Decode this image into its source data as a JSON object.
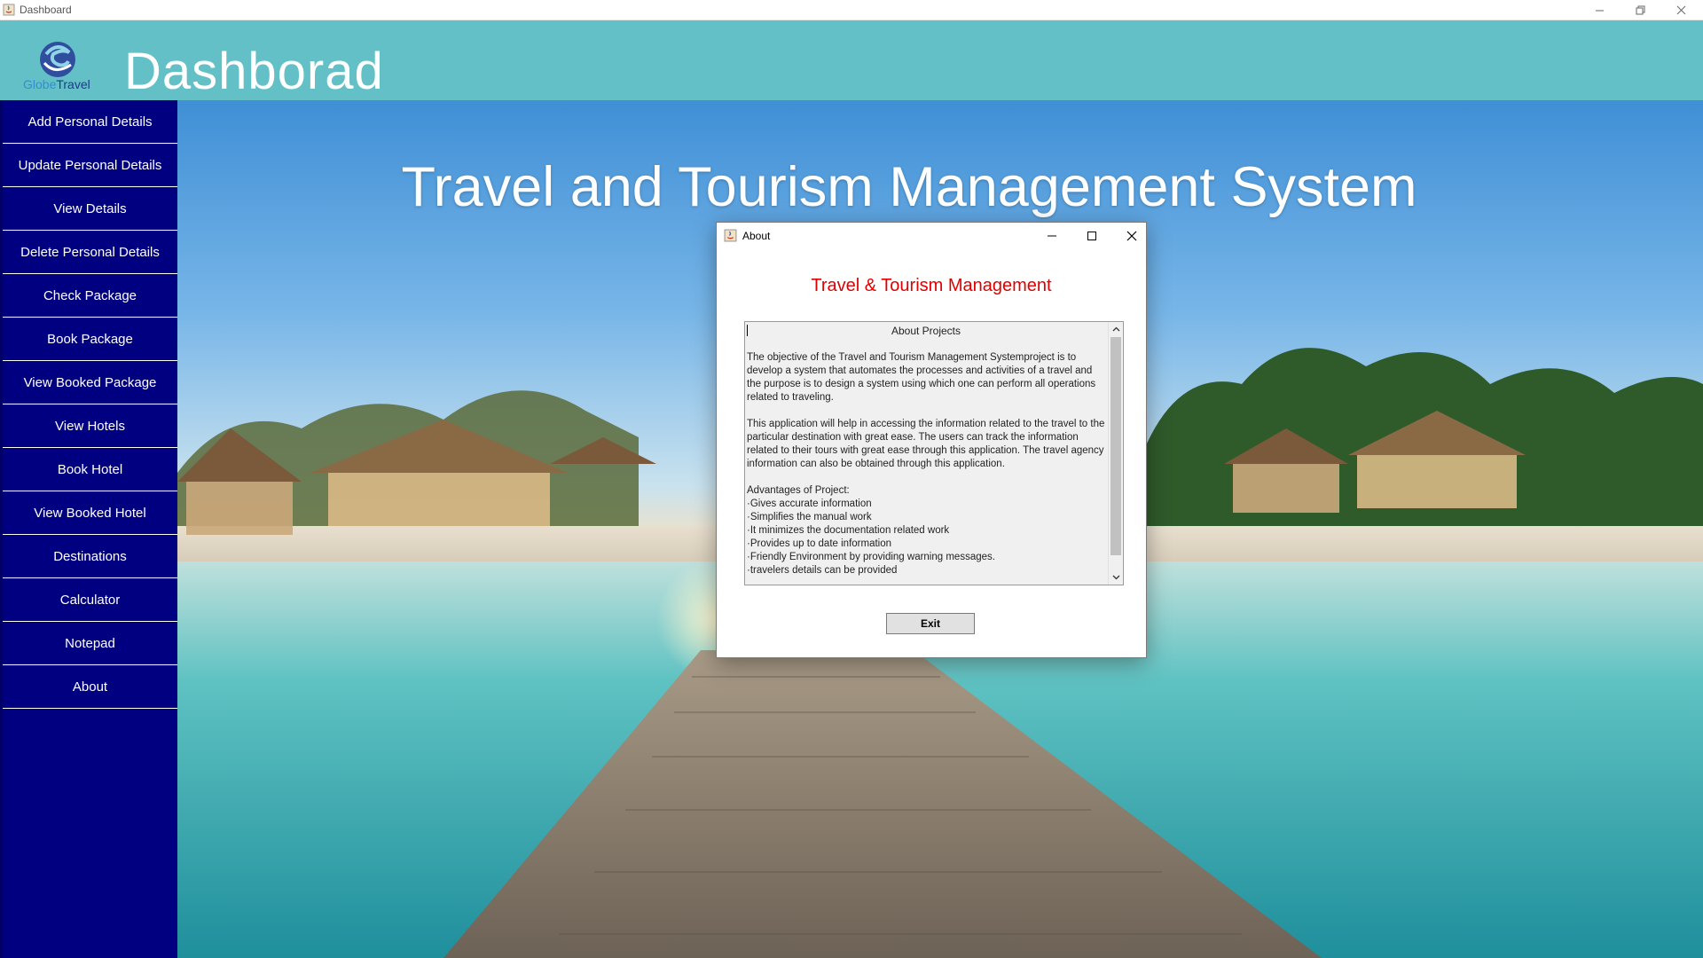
{
  "window": {
    "title": "Dashboard"
  },
  "header": {
    "title": "Dashborad",
    "logo": {
      "brand_a": "Globe",
      "brand_b": "Travel"
    }
  },
  "sidebar": {
    "items": [
      {
        "label": "Add Personal Details"
      },
      {
        "label": "Update Personal Details"
      },
      {
        "label": "View Details"
      },
      {
        "label": "Delete Personal Details"
      },
      {
        "label": "Check Package"
      },
      {
        "label": "Book Package"
      },
      {
        "label": "View Booked Package"
      },
      {
        "label": "View Hotels"
      },
      {
        "label": "Book Hotel"
      },
      {
        "label": "View Booked Hotel"
      },
      {
        "label": "Destinations"
      },
      {
        "label": "Calculator"
      },
      {
        "label": "Notepad"
      },
      {
        "label": "About"
      }
    ]
  },
  "main": {
    "banner_title": "Travel and Tourism Management System"
  },
  "dialog": {
    "title": "About",
    "heading": "Travel & Tourism Management",
    "text_heading": "About Projects",
    "paragraph_1": "The objective of the Travel and Tourism Management Systemproject is to develop a system that automates the processes and activities of a travel and the purpose is to design a system using which one can perform all operations related to traveling.",
    "paragraph_2": "This application will help in accessing the information related to the travel to the particular destination with great ease. The users can track the information related to their tours with great ease through this application. The travel agency information can also be obtained through this application.",
    "advantages_title": "Advantages of Project:",
    "advantages": [
      "·Gives accurate information",
      "·Simplifies the manual work",
      "·It minimizes the documentation related work",
      "·Provides up to date information",
      "·Friendly Environment by providing warning messages.",
      "·travelers details can be provided"
    ],
    "exit_label": "Exit"
  },
  "colors": {
    "header_bg": "#63c0c7",
    "sidebar_bg": "#000080",
    "dialog_heading": "#e00000"
  }
}
